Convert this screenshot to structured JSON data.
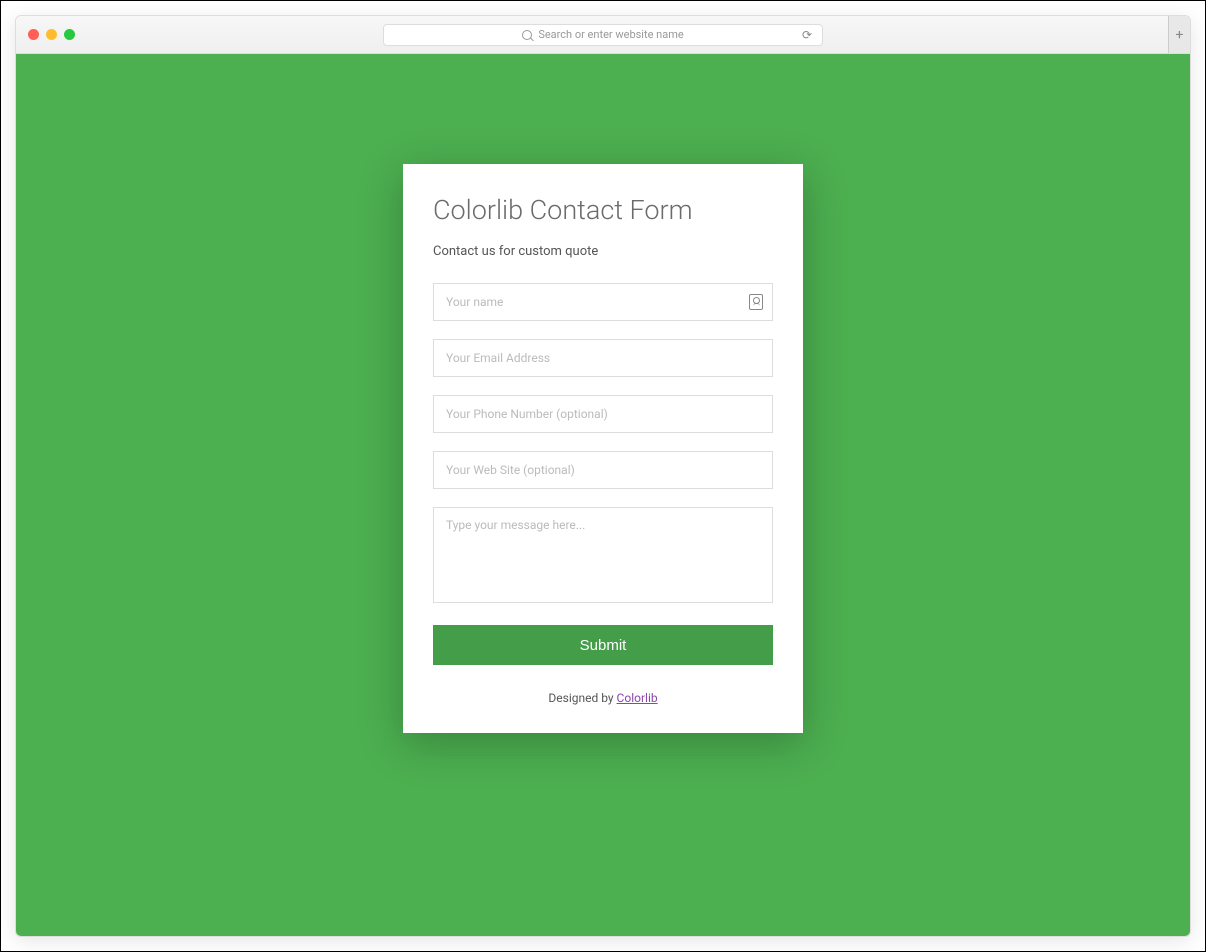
{
  "browser": {
    "address_placeholder": "Search or enter website name"
  },
  "form": {
    "title": "Colorlib Contact Form",
    "subtitle": "Contact us for custom quote",
    "fields": {
      "name": {
        "placeholder": "Your name",
        "value": ""
      },
      "email": {
        "placeholder": "Your Email Address",
        "value": ""
      },
      "phone": {
        "placeholder": "Your Phone Number (optional)",
        "value": ""
      },
      "website": {
        "placeholder": "Your Web Site (optional)",
        "value": ""
      },
      "message": {
        "placeholder": "Type your message here...",
        "value": ""
      }
    },
    "submit_label": "Submit",
    "credit_prefix": "Designed by ",
    "credit_link_text": "Colorlib"
  },
  "colors": {
    "page_bg": "#4caf50",
    "button_bg": "#449d48"
  }
}
